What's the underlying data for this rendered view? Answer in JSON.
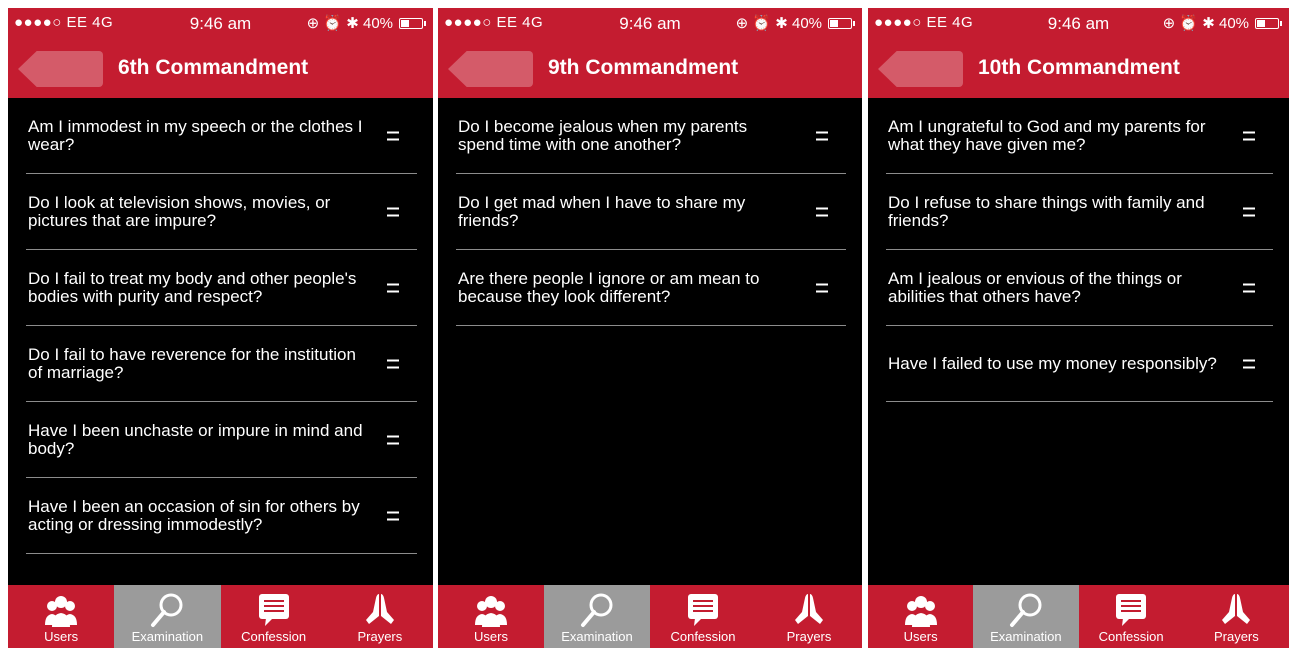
{
  "status": {
    "carrier": "●●●●○ EE  4G",
    "time": "9:46 am",
    "indicators": "⊕ ⏰ ✱ 40%",
    "battery_level_percent": 40
  },
  "tabs": [
    {
      "label": "Users",
      "icon": "users-icon"
    },
    {
      "label": "Examination",
      "icon": "search-icon"
    },
    {
      "label": "Confession",
      "icon": "chat-icon"
    },
    {
      "label": "Prayers",
      "icon": "praying-hands-icon"
    }
  ],
  "active_tab": "Examination",
  "colors": {
    "brand_red": "#c41c30",
    "active_tab_gray": "#9b9b9b",
    "list_bg": "#000000"
  },
  "screens": [
    {
      "title": "6th Commandment",
      "questions": [
        "Am I immodest in my speech or the clothes I wear?",
        "Do I look at television shows, movies, or pictures that are impure?",
        "Do I fail to treat my body and other people's bodies with purity and respect?",
        "Do I fail to have reverence for the institution of marriage?",
        "Have I been unchaste or impure in mind and body?",
        "Have I been an occasion of sin for others by acting or dressing immodestly?"
      ]
    },
    {
      "title": "9th Commandment",
      "questions": [
        "Do I become jealous when my parents spend time with one another?",
        "Do I get mad when I have to share my friends?",
        "Are there people I ignore or am mean to because they look different?"
      ]
    },
    {
      "title": "10th Commandment",
      "questions": [
        "Am I ungrateful to God and my parents for what they have given me?",
        "Do I refuse to share things with family and friends?",
        "Am I jealous or envious of the things or abilities that others have?",
        "Have I failed to use my money responsibly?"
      ]
    }
  ]
}
